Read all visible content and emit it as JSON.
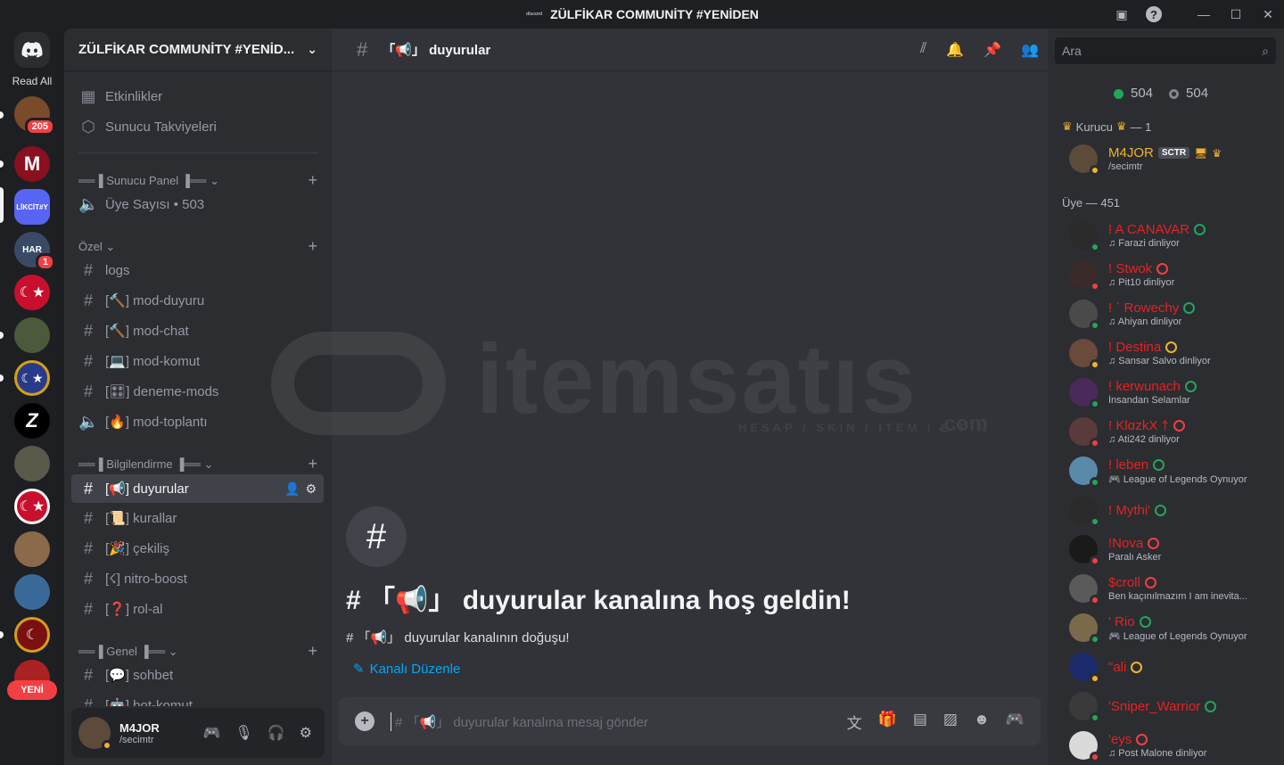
{
  "window": {
    "title": "ZÜLFİKAR COMMUNİTY #YENİDEN",
    "logo_text": "discord"
  },
  "rail": {
    "read_all": "Read All",
    "new_label": "YENİ",
    "servers": [
      {
        "label": "",
        "badge": "205",
        "color": "#7a4a2a"
      },
      {
        "label": "M",
        "badge": "",
        "color": "#8a1020"
      },
      {
        "label": "LİKCİT#Y",
        "badge": "",
        "color": "#5865f2"
      },
      {
        "label": "HAR",
        "badge": "1",
        "color": "#3a4a66"
      },
      {
        "label": "☾★",
        "badge": "",
        "color": "#c8102e"
      },
      {
        "label": "",
        "badge": "",
        "color": "#4a5a3a"
      },
      {
        "label": "☾★",
        "badge": "",
        "color": "#2a3a8a"
      },
      {
        "label": "Z",
        "badge": "",
        "color": "#000000"
      },
      {
        "label": "",
        "badge": "",
        "color": "#5a5a4a"
      },
      {
        "label": "☾★",
        "badge": "",
        "color": "#c8102e"
      },
      {
        "label": "",
        "badge": "",
        "color": "#8a6a4a"
      },
      {
        "label": "",
        "badge": "",
        "color": "#3a6a9a"
      },
      {
        "label": "☾",
        "badge": "",
        "color": "#7a1010"
      },
      {
        "label": "",
        "badge": "",
        "color": "#aa2222"
      }
    ]
  },
  "guild": {
    "name": "ZÜLFİKAR COMMUNİTY #YENİD...",
    "top_items": [
      "Etkinlikler",
      "Sunucu Takviyeleri"
    ],
    "cat1": "══▐ Sunucu Panel ▐══",
    "member_count": "Üye Sayısı • 503",
    "cat2": "Özel",
    "cat2_channels": [
      "logs",
      "[🔨] mod-duyuru",
      "[🔨] mod-chat",
      "[💻] mod-komut",
      "[🎛] deneme-mods",
      "[🔥] mod-toplantı"
    ],
    "cat3": "══▐ Bilgilendirme ▐══",
    "cat3_channels": [
      "[📢] duyurular",
      "[📜] kurallar",
      "[🎉] çekiliş",
      "[☇] nitro-boost",
      "[❓] rol-al"
    ],
    "cat4": "══▐ Genel ▐══",
    "cat4_channels": [
      "[💬] sohbet",
      "[🤖] bot-komut"
    ]
  },
  "user": {
    "name": "M4JOR",
    "sub": "/secimtr"
  },
  "channel": {
    "name": "「📢」 duyurular",
    "welcome_title": "# 「📢」 duyurular kanalına hoş geldin!",
    "welcome_desc": "# 「📢」 duyurular kanalının doğuşu!",
    "edit_label": "Kanalı Düzenle",
    "composer_placeholder": "# 「📢」 duyurular kanalına mesaj gönder"
  },
  "watermark": {
    "text": "itemsatıs",
    "sub": "HESAP / SKIN / ITEM / E-PIN",
    "com": ".com"
  },
  "members": {
    "search_placeholder": "Ara",
    "online": "504",
    "offline": "504",
    "owner_group": "Kurucu",
    "owner_count": "— 1",
    "owner": {
      "name": "M4JOR",
      "tag": "SCTR",
      "sub": "/secimtr",
      "color": "#f0b232"
    },
    "member_group": "Üye — 451",
    "list": [
      {
        "name": "! A CANAVAR",
        "activity": "♫ Farazi dinliyor",
        "color": "#e62222",
        "status": "#23a55a",
        "avatar": "#2a2a2a"
      },
      {
        "name": "! Stwok",
        "activity": "♫ Pit10 dinliyor",
        "color": "#e62222",
        "status": "#f23f43",
        "avatar": "#3a2a2a"
      },
      {
        "name": "! ` Rowechy",
        "activity": "♫ Ahiyan dinliyor",
        "color": "#e62222",
        "status": "#23a55a",
        "avatar": "#4a4a4a"
      },
      {
        "name": "! Destina",
        "activity": "♫ Sansar Salvo dinliyor",
        "color": "#e62222",
        "status": "#f0b232",
        "avatar": "#6a4a3a"
      },
      {
        "name": "! kerwunach",
        "activity": "İnsandan Selamlar",
        "color": "#e62222",
        "status": "#23a55a",
        "avatar": "#4a2a5a"
      },
      {
        "name": "! KlαzkX †",
        "activity": "♫ Ati242 dinliyor",
        "color": "#e62222",
        "status": "#f23f43",
        "avatar": "#5a3a3a"
      },
      {
        "name": "! leben",
        "activity": "🎮 League of Legends Oynuyor",
        "color": "#e62222",
        "status": "#23a55a",
        "avatar": "#5a8aaa"
      },
      {
        "name": "! Mythi'",
        "activity": "",
        "color": "#e62222",
        "status": "#23a55a",
        "avatar": "#2a2a2a"
      },
      {
        "name": "!Nova",
        "activity": "Paralı Asker",
        "color": "#e62222",
        "status": "#f23f43",
        "avatar": "#1a1a1a"
      },
      {
        "name": "$croll",
        "activity": "Ben kaçınılmazım I am inevita...",
        "color": "#e62222",
        "status": "#f23f43",
        "avatar": "#5a5a5a"
      },
      {
        "name": "' Rio",
        "activity": "🎮 League of Legends Oynuyor",
        "color": "#e62222",
        "status": "#23a55a",
        "avatar": "#7a6a4a"
      },
      {
        "name": "\"ali",
        "activity": "",
        "color": "#e62222",
        "status": "#f0b232",
        "avatar": "#1a2a6a"
      },
      {
        "name": "'Sniper_Warrior",
        "activity": "",
        "color": "#e62222",
        "status": "#23a55a",
        "avatar": "#3a3a3a"
      },
      {
        "name": "'eys",
        "activity": "♫ Post Malone dinliyor",
        "color": "#e62222",
        "status": "#f23f43",
        "avatar": "#dadada"
      }
    ]
  }
}
